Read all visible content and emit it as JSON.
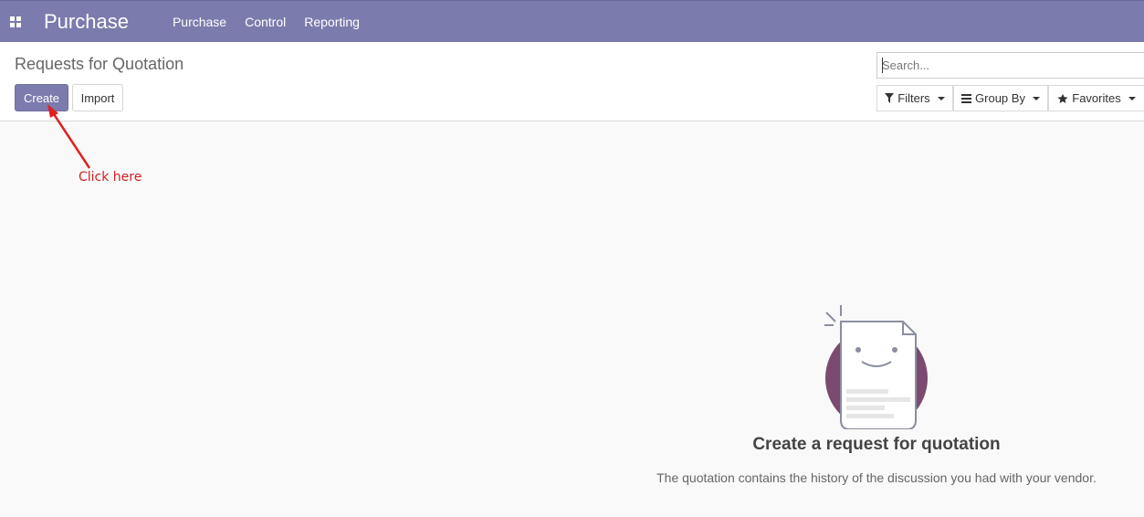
{
  "navbar": {
    "app_name": "Purchase",
    "menu": [
      "Purchase",
      "Control",
      "Reporting"
    ]
  },
  "control_panel": {
    "breadcrumb": "Requests for Quotation",
    "create_label": "Create",
    "import_label": "Import",
    "search_placeholder": "Search...",
    "filters_label": "Filters",
    "groupby_label": "Group By",
    "favorites_label": "Favorites"
  },
  "annotation": {
    "text": "Click here",
    "color": "#d21f1f"
  },
  "empty_state": {
    "title": "Create a request for quotation",
    "description": "The quotation contains the history of the discussion you had with your vendor."
  },
  "colors": {
    "brand": "#7c7bad",
    "accent_circle": "#7b4a6e"
  }
}
